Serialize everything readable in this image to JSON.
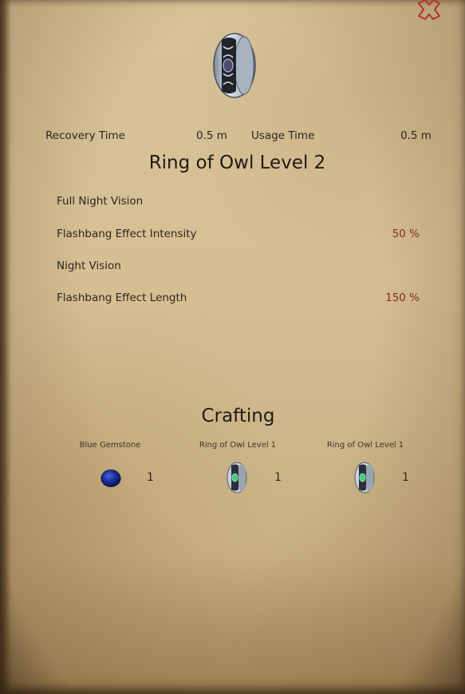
{
  "item": {
    "name": "Ring of Owl Level 2",
    "icon": "ring-icon"
  },
  "stats": {
    "recovery_label": "Recovery Time",
    "recovery_value": "0.5 m",
    "usage_label": "Usage Time",
    "usage_value": "0.5 m"
  },
  "attributes": [
    {
      "name": "Full Night Vision",
      "value": ""
    },
    {
      "name": "Flashbang Effect Intensity",
      "value": "50 %"
    },
    {
      "name": "Night Vision",
      "value": ""
    },
    {
      "name": "Flashbang Effect Length",
      "value": "150 %"
    }
  ],
  "crafting": {
    "title": "Crafting",
    "ingredients": [
      {
        "name": "Blue Gemstone",
        "qty": "1",
        "icon": "blue-gemstone-icon"
      },
      {
        "name": "Ring of Owl Level 1",
        "qty": "1",
        "icon": "ring-icon"
      },
      {
        "name": "Ring of Owl Level 1",
        "qty": "1",
        "icon": "ring-icon"
      }
    ]
  },
  "colors": {
    "value_accent": "#8a2a1a",
    "close_icon": "#b8322a",
    "parchment": "#d8c39a"
  }
}
